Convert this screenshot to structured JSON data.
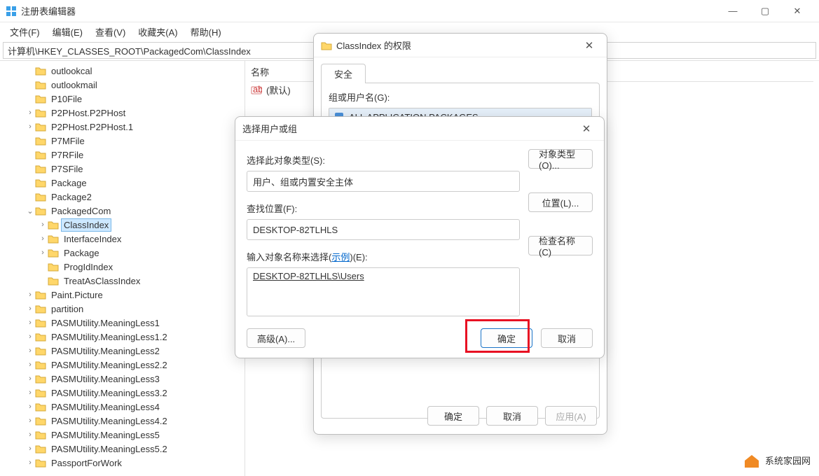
{
  "window": {
    "title": "注册表编辑器"
  },
  "menu": {
    "file": "文件(F)",
    "edit": "编辑(E)",
    "view": "查看(V)",
    "fav": "收藏夹(A)",
    "help": "帮助(H)"
  },
  "address": "计算机\\HKEY_CLASSES_ROOT\\PackagedCom\\ClassIndex",
  "tree": [
    {
      "d": 2,
      "t": "outlookcal"
    },
    {
      "d": 2,
      "t": "outlookmail"
    },
    {
      "d": 2,
      "t": "P10File"
    },
    {
      "d": 2,
      "t": "P2PHost.P2PHost",
      "c": ">"
    },
    {
      "d": 2,
      "t": "P2PHost.P2PHost.1",
      "c": ">"
    },
    {
      "d": 2,
      "t": "P7MFile"
    },
    {
      "d": 2,
      "t": "P7RFile"
    },
    {
      "d": 2,
      "t": "P7SFile"
    },
    {
      "d": 2,
      "t": "Package"
    },
    {
      "d": 2,
      "t": "Package2"
    },
    {
      "d": 2,
      "t": "PackagedCom",
      "c": "v"
    },
    {
      "d": 3,
      "t": "ClassIndex",
      "c": ">",
      "sel": true
    },
    {
      "d": 3,
      "t": "InterfaceIndex",
      "c": ">"
    },
    {
      "d": 3,
      "t": "Package",
      "c": ">"
    },
    {
      "d": 3,
      "t": "ProgIdIndex"
    },
    {
      "d": 3,
      "t": "TreatAsClassIndex"
    },
    {
      "d": 2,
      "t": "Paint.Picture",
      "c": ">"
    },
    {
      "d": 2,
      "t": "partition",
      "c": ">"
    },
    {
      "d": 2,
      "t": "PASMUtility.MeaningLess1",
      "c": ">"
    },
    {
      "d": 2,
      "t": "PASMUtility.MeaningLess1.2",
      "c": ">"
    },
    {
      "d": 2,
      "t": "PASMUtility.MeaningLess2",
      "c": ">"
    },
    {
      "d": 2,
      "t": "PASMUtility.MeaningLess2.2",
      "c": ">"
    },
    {
      "d": 2,
      "t": "PASMUtility.MeaningLess3",
      "c": ">"
    },
    {
      "d": 2,
      "t": "PASMUtility.MeaningLess3.2",
      "c": ">"
    },
    {
      "d": 2,
      "t": "PASMUtility.MeaningLess4",
      "c": ">"
    },
    {
      "d": 2,
      "t": "PASMUtility.MeaningLess4.2",
      "c": ">"
    },
    {
      "d": 2,
      "t": "PASMUtility.MeaningLess5",
      "c": ">"
    },
    {
      "d": 2,
      "t": "PASMUtility.MeaningLess5.2",
      "c": ">"
    },
    {
      "d": 2,
      "t": "PassportForWork",
      "c": ">"
    }
  ],
  "list": {
    "hdr_name": "名称",
    "default": "(默认)"
  },
  "perm": {
    "title": "ClassIndex 的权限",
    "tab": "安全",
    "group_label": "组或用户名(G):",
    "item": "ALL APPLICATION PACKAGES",
    "ok": "确定",
    "cancel": "取消",
    "apply": "应用(A)"
  },
  "sel": {
    "title": "选择用户或组",
    "obj_type_label": "选择此对象类型(S):",
    "obj_type": "用户、组或内置安全主体",
    "btn_obj": "对象类型(O)...",
    "loc_label": "查找位置(F):",
    "loc": "DESKTOP-82TLHLS",
    "btn_loc": "位置(L)...",
    "name_label_pre": "输入对象名称来选择(",
    "name_label_link": "示例",
    "name_label_post": ")(E):",
    "name_value": "DESKTOP-82TLHLS\\Users",
    "btn_check": "检查名称(C)",
    "btn_adv": "高级(A)...",
    "ok": "确定",
    "cancel": "取消"
  },
  "watermark": "系统家园网"
}
